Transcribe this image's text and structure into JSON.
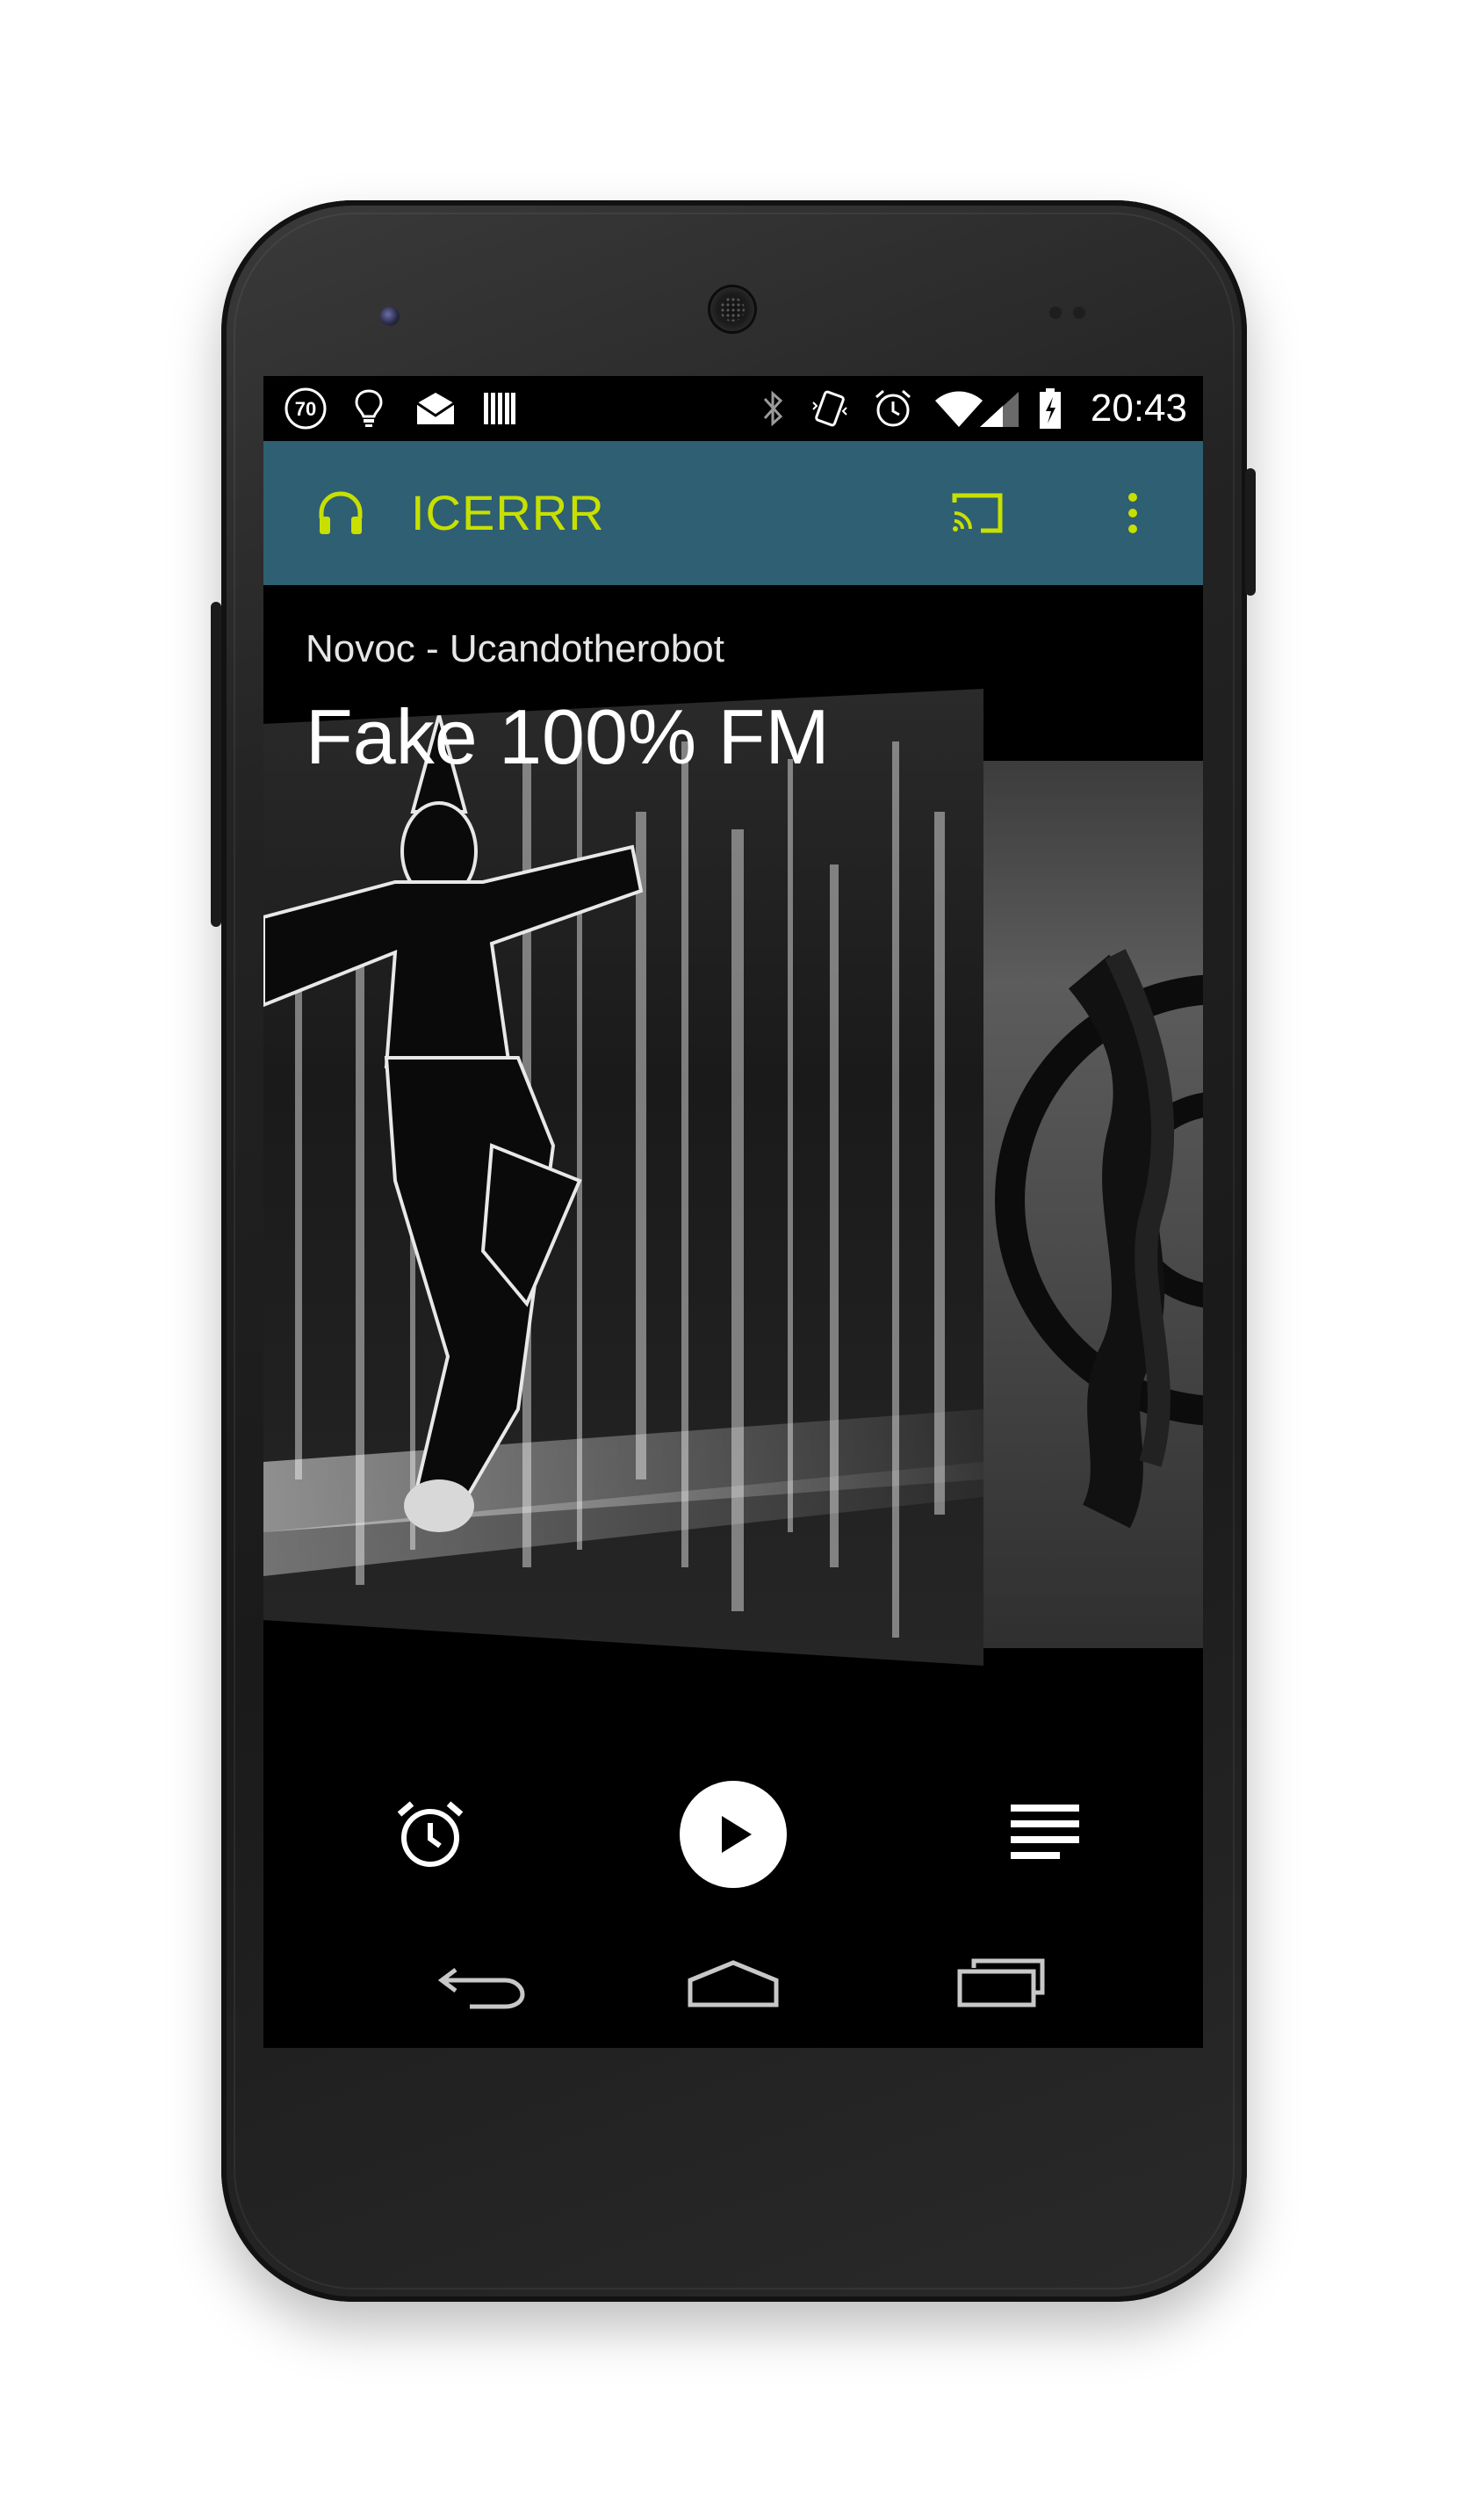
{
  "status_bar": {
    "notification_count": "70",
    "time": "20:43"
  },
  "toolbar": {
    "app_name": "ICERRR",
    "icon_left": "headphones-icon",
    "actions": [
      "cast-icon",
      "overflow-menu-icon"
    ]
  },
  "now_playing": {
    "artist_track": "Novoc - Ucandotherobot",
    "station": "Fake 100% FM"
  },
  "controls": [
    "alarm-icon",
    "play-icon",
    "playlist-icon"
  ],
  "nav": [
    "back-icon",
    "home-icon",
    "recents-icon"
  ],
  "colors": {
    "toolbar_bg": "#2e5f73",
    "accent": "#c7e000",
    "screen_bg": "#000000"
  }
}
